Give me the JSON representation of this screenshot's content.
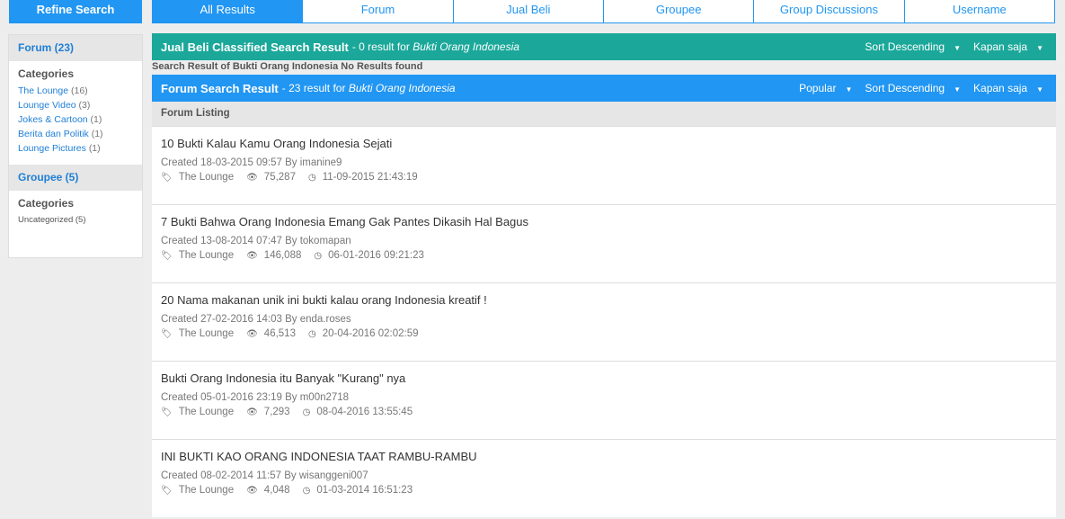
{
  "refine_label": "Refine Search",
  "tabs": [
    "All Results",
    "Forum",
    "Jual Beli",
    "Groupee",
    "Group Discussions",
    "Username"
  ],
  "sidebar": {
    "forum_head": "Forum (23)",
    "categories_label": "Categories",
    "forum_cats": [
      {
        "name": "The Lounge",
        "count": "(16)"
      },
      {
        "name": "Lounge Video",
        "count": "(3)"
      },
      {
        "name": "Jokes & Cartoon",
        "count": "(1)"
      },
      {
        "name": "Berita dan Politik",
        "count": "(1)"
      },
      {
        "name": "Lounge Pictures",
        "count": "(1)"
      }
    ],
    "groupee_head": "Groupee (5)",
    "groupee_categories_label": "Categories",
    "groupee_cat": "Uncategorized (5)"
  },
  "jual": {
    "title": "Jual Beli Classified Search Result",
    "sub": "- 0 result for",
    "query": "Bukti Orang Indonesia",
    "sort": "Sort Descending",
    "time": "Kapan saja"
  },
  "no_result_text": "Search Result of Bukti Orang Indonesia No Results found",
  "forum": {
    "title": "Forum Search Result",
    "sub": "- 23 result for",
    "query": "Bukti Orang Indonesia",
    "popular": "Popular",
    "sort": "Sort Descending",
    "time": "Kapan saja"
  },
  "listing_label": "Forum Listing",
  "items": [
    {
      "title": "10 Bukti Kalau Kamu Orang Indonesia Sejati",
      "created": "Created 18-03-2015 09:57 By imanine9",
      "category": "The Lounge",
      "views": "75,287",
      "last": "11-09-2015 21:43:19"
    },
    {
      "title": "7 Bukti Bahwa Orang Indonesia Emang Gak Pantes Dikasih Hal Bagus",
      "created": "Created 13-08-2014 07:47 By tokomapan",
      "category": "The Lounge",
      "views": "146,088",
      "last": "06-01-2016 09:21:23"
    },
    {
      "title": "20 Nama makanan unik ini bukti kalau orang Indonesia kreatif !",
      "created": "Created 27-02-2016 14:03 By enda.roses",
      "category": "The Lounge",
      "views": "46,513",
      "last": "20-04-2016 02:02:59"
    },
    {
      "title": "Bukti Orang Indonesia itu Banyak \"Kurang\" nya",
      "created": "Created 05-01-2016 23:19 By m00n2718",
      "category": "The Lounge",
      "views": "7,293",
      "last": "08-04-2016 13:55:45"
    },
    {
      "title": "INI BUKTI KAO ORANG INDONESIA TAAT RAMBU-RAMBU",
      "created": "Created 08-02-2014 11:57 By wisanggeni007",
      "category": "The Lounge",
      "views": "4,048",
      "last": "01-03-2014 16:51:23"
    }
  ]
}
